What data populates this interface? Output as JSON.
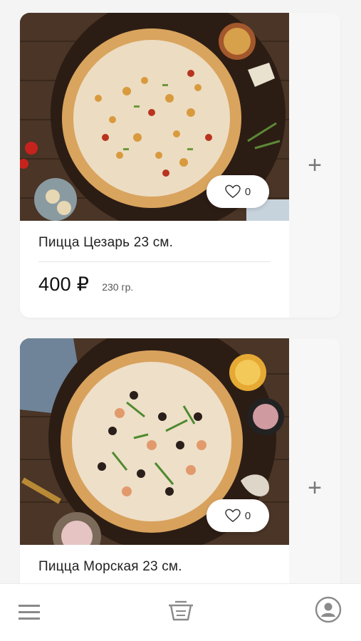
{
  "products": [
    {
      "name": "Пицца Цезарь 23 см.",
      "price": "400 ₽",
      "weight": "230 гр.",
      "likes": "0",
      "add_label": "+"
    },
    {
      "name": "Пицца Морская 23 см.",
      "likes": "0",
      "add_label": "+"
    }
  ],
  "nav": {
    "items": [
      "menu-icon",
      "cart-icon",
      "profile-icon"
    ]
  },
  "colors": {
    "background": "#f4f4f4",
    "card": "#ffffff",
    "side_panel": "#f7f7f7",
    "icon_gray": "#888888"
  }
}
